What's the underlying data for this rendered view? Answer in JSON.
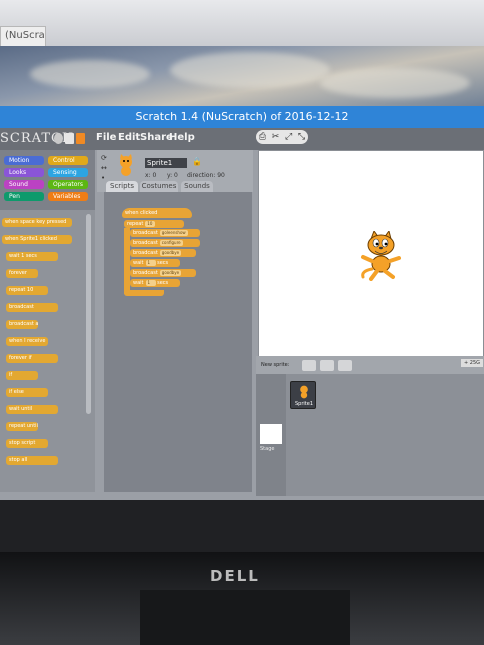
{
  "browser": {
    "tab_label": "(NuScratch)"
  },
  "window": {
    "title": "Scratch 1.4 (NuScratch) of 2016-12-12"
  },
  "app": {
    "logo": "SCRATCH",
    "menu": [
      "File",
      "Edit",
      "Share",
      "Help"
    ],
    "categories": [
      {
        "label": "Motion",
        "color": "#4a6cd4"
      },
      {
        "label": "Control",
        "color": "#e1a91a"
      },
      {
        "label": "Looks",
        "color": "#8a55d7"
      },
      {
        "label": "Sensing",
        "color": "#2ca5e2"
      },
      {
        "label": "Sound",
        "color": "#bb42c3"
      },
      {
        "label": "Operators",
        "color": "#5cb712"
      },
      {
        "label": "Pen",
        "color": "#0e9a6c"
      },
      {
        "label": "Variables",
        "color": "#ee7d16"
      }
    ],
    "palette_blocks": [
      "when space key pressed",
      "when Sprite1 clicked",
      "wait 1 secs",
      "forever",
      "repeat 10",
      "broadcast",
      "broadcast and wait",
      "when I receive",
      "forever if",
      "if",
      "if else",
      "wait until",
      "repeat until",
      "stop script",
      "stop all"
    ],
    "sprite_info": {
      "name": "Sprite1",
      "x_label": "x: 0",
      "y_label": "y: 0",
      "direction_label": "direction: 90"
    },
    "tabs": [
      "Scripts",
      "Costumes",
      "Sounds"
    ],
    "script": {
      "hat": "when clicked",
      "repeat": "repeat",
      "repeat_count": "10",
      "lines": [
        {
          "text": "broadcast",
          "value": "goleenshow"
        },
        {
          "text": "broadcast",
          "value": "configure"
        },
        {
          "text": "broadcast",
          "value": "goodbye"
        },
        {
          "text": "wait",
          "value": "1",
          "suffix": "secs"
        },
        {
          "text": "broadcast",
          "value": "goodbye"
        },
        {
          "text": "wait",
          "value": "1",
          "suffix": "secs"
        }
      ]
    },
    "sprite_panel": {
      "new_sprite_label": "New sprite:",
      "sprite_tile_label": "Sprite1",
      "stage_label": "Stage",
      "zoom": "+ 25G"
    }
  },
  "hardware": {
    "brand": "DELL"
  }
}
